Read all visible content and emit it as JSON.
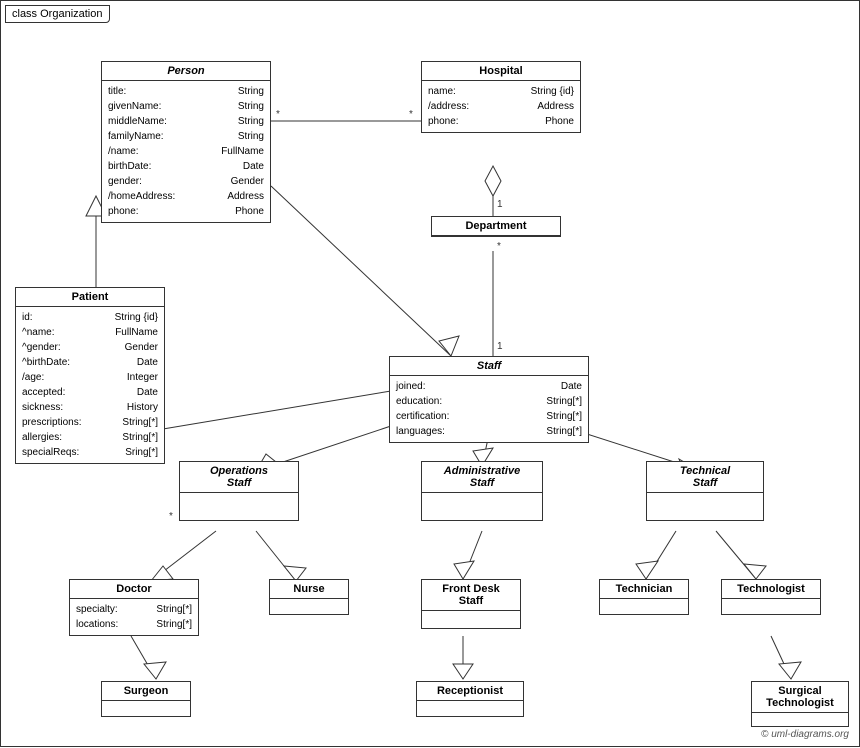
{
  "diagram": {
    "title": "class Organization",
    "copyright": "© uml-diagrams.org",
    "classes": {
      "person": {
        "name": "Person",
        "italic": true,
        "attrs": [
          [
            "title:",
            "String"
          ],
          [
            "givenName:",
            "String"
          ],
          [
            "middleName:",
            "String"
          ],
          [
            "familyName:",
            "String"
          ],
          [
            "/name:",
            "FullName"
          ],
          [
            "birthDate:",
            "Date"
          ],
          [
            "gender:",
            "Gender"
          ],
          [
            "/homeAddress:",
            "Address"
          ],
          [
            "phone:",
            "Phone"
          ]
        ]
      },
      "hospital": {
        "name": "Hospital",
        "italic": false,
        "attrs": [
          [
            "name:",
            "String {id}"
          ],
          [
            "/address:",
            "Address"
          ],
          [
            "phone:",
            "Phone"
          ]
        ]
      },
      "patient": {
        "name": "Patient",
        "italic": false,
        "attrs": [
          [
            "id:",
            "String {id}"
          ],
          [
            "^name:",
            "FullName"
          ],
          [
            "^gender:",
            "Gender"
          ],
          [
            "^birthDate:",
            "Date"
          ],
          [
            "/age:",
            "Integer"
          ],
          [
            "accepted:",
            "Date"
          ],
          [
            "sickness:",
            "History"
          ],
          [
            "prescriptions:",
            "String[*]"
          ],
          [
            "allergies:",
            "String[*]"
          ],
          [
            "specialReqs:",
            "Sring[*]"
          ]
        ]
      },
      "department": {
        "name": "Department",
        "italic": false,
        "attrs": []
      },
      "staff": {
        "name": "Staff",
        "italic": true,
        "attrs": [
          [
            "joined:",
            "Date"
          ],
          [
            "education:",
            "String[*]"
          ],
          [
            "certification:",
            "String[*]"
          ],
          [
            "languages:",
            "String[*]"
          ]
        ]
      },
      "operations_staff": {
        "name": "Operations\nStaff",
        "italic": true,
        "attrs": []
      },
      "administrative_staff": {
        "name": "Administrative\nStaff",
        "italic": true,
        "attrs": []
      },
      "technical_staff": {
        "name": "Technical\nStaff",
        "italic": true,
        "attrs": []
      },
      "doctor": {
        "name": "Doctor",
        "italic": false,
        "attrs": [
          [
            "specialty:",
            "String[*]"
          ],
          [
            "locations:",
            "String[*]"
          ]
        ]
      },
      "nurse": {
        "name": "Nurse",
        "italic": false,
        "attrs": []
      },
      "front_desk_staff": {
        "name": "Front Desk\nStaff",
        "italic": false,
        "attrs": []
      },
      "technician": {
        "name": "Technician",
        "italic": false,
        "attrs": []
      },
      "technologist": {
        "name": "Technologist",
        "italic": false,
        "attrs": []
      },
      "surgeon": {
        "name": "Surgeon",
        "italic": false,
        "attrs": []
      },
      "receptionist": {
        "name": "Receptionist",
        "italic": false,
        "attrs": []
      },
      "surgical_technologist": {
        "name": "Surgical\nTechnologist",
        "italic": false,
        "attrs": []
      }
    }
  }
}
